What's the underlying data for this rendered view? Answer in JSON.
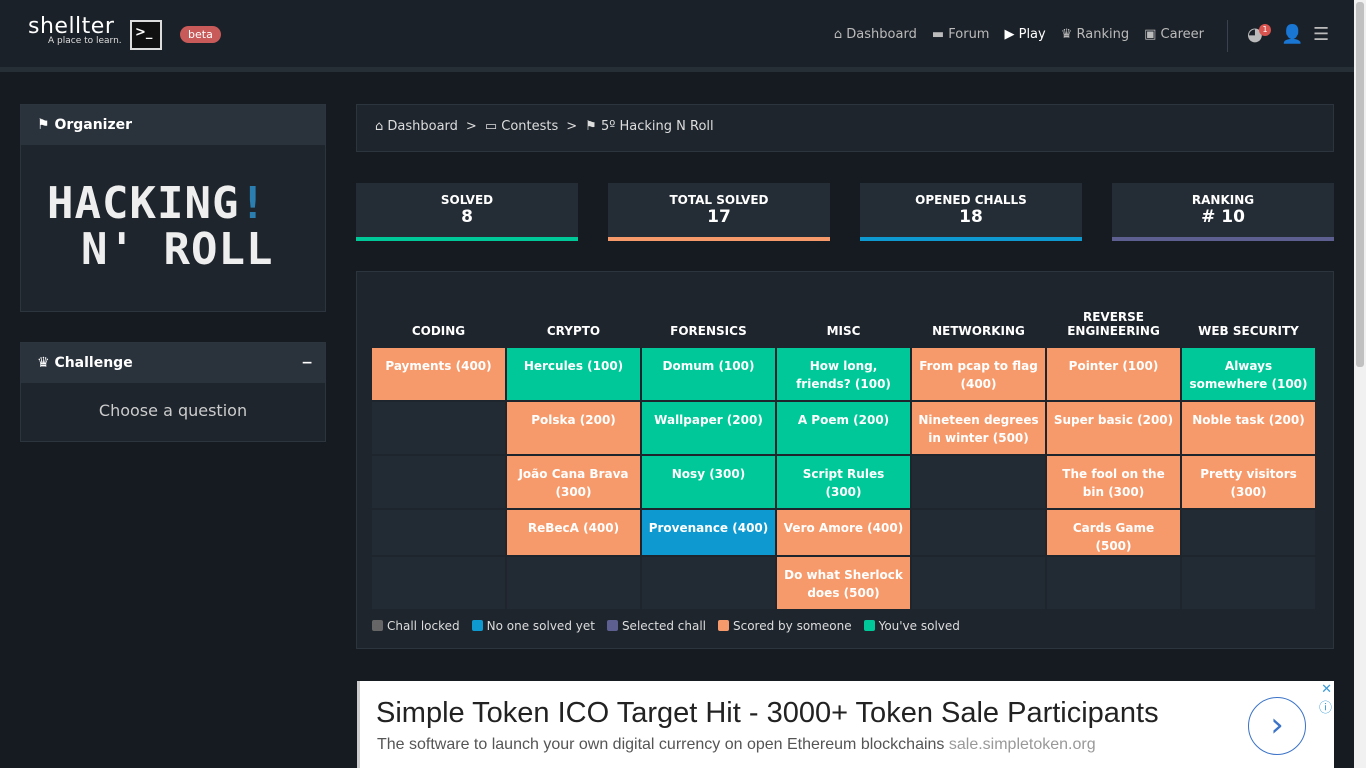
{
  "brand": {
    "name": "shellter",
    "tagline": "A place to learn.",
    "badge": "beta"
  },
  "nav": {
    "items": [
      {
        "icon": "home-icon",
        "label": "Dashboard"
      },
      {
        "icon": "folder-icon",
        "label": "Forum"
      },
      {
        "icon": "play-icon",
        "label": "Play"
      },
      {
        "icon": "trophy-icon",
        "label": "Ranking"
      },
      {
        "icon": "briefcase-icon",
        "label": "Career"
      }
    ],
    "notifications": "1"
  },
  "organizer": {
    "title": "Organizer",
    "logo_text": "HACKING N' ROLL!"
  },
  "challenge": {
    "title": "Challenge",
    "collapse": "−",
    "placeholder": "Choose a question"
  },
  "breadcrumb": [
    "Dashboard",
    "Contests",
    "5º Hacking N Roll"
  ],
  "stats": [
    {
      "label": "SOLVED",
      "value": "8",
      "color": "#00c898"
    },
    {
      "label": "TOTAL SOLVED",
      "value": "17",
      "color": "#f79a6b"
    },
    {
      "label": "OPENED CHALLS",
      "value": "18",
      "color": "#0e9ad0"
    },
    {
      "label": "RANKING",
      "value": "# 10",
      "color": "#5d5f91"
    }
  ],
  "colors": {
    "locked": "#666666",
    "unsolved": "#0e9ad0",
    "selected": "#5d5f91",
    "scored": "#f79a6b",
    "solved": "#00c898"
  },
  "categories": [
    "CODING",
    "CRYPTO",
    "FORENSICS",
    "MISC",
    "NETWORKING",
    "REVERSE ENGINEERING",
    "WEB SECURITY"
  ],
  "rows": [
    [
      {
        "t": "Payments (400)",
        "s": "scored"
      },
      {
        "t": "Hercules (100)",
        "s": "solved"
      },
      {
        "t": "Domum (100)",
        "s": "solved"
      },
      {
        "t": "How long, friends? (100)",
        "s": "solved"
      },
      {
        "t": "From pcap to flag (400)",
        "s": "scored"
      },
      {
        "t": "Pointer (100)",
        "s": "scored"
      },
      {
        "t": "Always somewhere (100)",
        "s": "solved"
      }
    ],
    [
      null,
      {
        "t": "Polska (200)",
        "s": "scored"
      },
      {
        "t": "Wallpaper (200)",
        "s": "solved"
      },
      {
        "t": "A Poem (200)",
        "s": "solved"
      },
      {
        "t": "Nineteen degrees in winter (500)",
        "s": "scored"
      },
      {
        "t": "Super basic (200)",
        "s": "scored"
      },
      {
        "t": "Noble task (200)",
        "s": "scored"
      }
    ],
    [
      null,
      {
        "t": "João Cana Brava (300)",
        "s": "scored"
      },
      {
        "t": "Nosy (300)",
        "s": "solved"
      },
      {
        "t": "Script Rules (300)",
        "s": "solved"
      },
      null,
      {
        "t": "The fool on the bin (300)",
        "s": "scored"
      },
      {
        "t": "Pretty visitors (300)",
        "s": "scored"
      }
    ],
    [
      null,
      {
        "t": "ReBecA (400)",
        "s": "scored"
      },
      {
        "t": "Provenance (400)",
        "s": "unsolved"
      },
      {
        "t": "Vero Amore (400)",
        "s": "scored"
      },
      null,
      {
        "t": "Cards Game (500)",
        "s": "scored"
      },
      null
    ],
    [
      null,
      null,
      null,
      {
        "t": "Do what Sherlock does (500)",
        "s": "scored"
      },
      null,
      null,
      null
    ]
  ],
  "legend": [
    {
      "k": "locked",
      "label": "Chall locked"
    },
    {
      "k": "unsolved",
      "label": "No one solved yet"
    },
    {
      "k": "selected",
      "label": "Selected chall"
    },
    {
      "k": "scored",
      "label": "Scored by someone"
    },
    {
      "k": "solved",
      "label": "You've solved"
    }
  ],
  "ad": {
    "title": "Simple Token ICO Target Hit - 3000+ Token Sale Participants",
    "desc": "The software to launch your own digital currency on open Ethereum blockchains",
    "domain": "sale.simpletoken.org",
    "close": "✕",
    "info": "ⓘ"
  }
}
